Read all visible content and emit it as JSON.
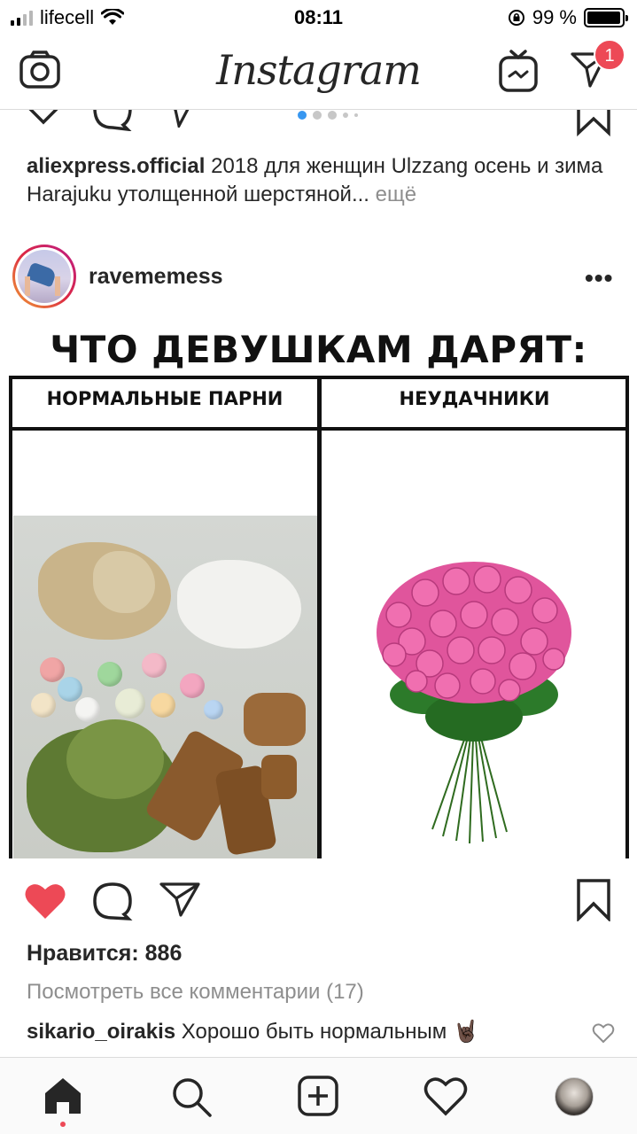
{
  "status_bar": {
    "carrier": "lifecell",
    "time": "08:11",
    "battery_percent": "99 %",
    "battery_level": 0.99,
    "signal_bars": 4,
    "signal_bars_filled": 2
  },
  "header": {
    "logo": "Instagram",
    "direct_badge": "1",
    "badge_color": "#ed4956"
  },
  "previous_post": {
    "carousel_active_index": 0,
    "caption_user": "aliexpress.official",
    "caption_text": " 2018 для женщин Ulzzang осень и зима Harajuku утолщенной шерстяной...",
    "caption_more": " ещё"
  },
  "post": {
    "username": "ravememess",
    "more_label": "•••",
    "image": {
      "title": "ЧТО ДЕВУШКАМ ДАРЯТ:",
      "left_header": "НОРМАЛЬНЫЕ ПАРНИ",
      "right_header": "НЕУДАЧНИКИ"
    },
    "liked": true,
    "like_color": "#ed4956",
    "likes_text": "Нравится: 886",
    "view_comments": "Посмотреть все комментарии (17)",
    "comment": {
      "user": "sikario_oirakis",
      "text": " Хорошо быть нормальным 🤘🏿"
    }
  },
  "bottom_nav": {
    "items": [
      "home-icon",
      "search-icon",
      "add-post-icon",
      "activity-heart-icon",
      "profile-avatar"
    ],
    "active": "home-icon"
  }
}
